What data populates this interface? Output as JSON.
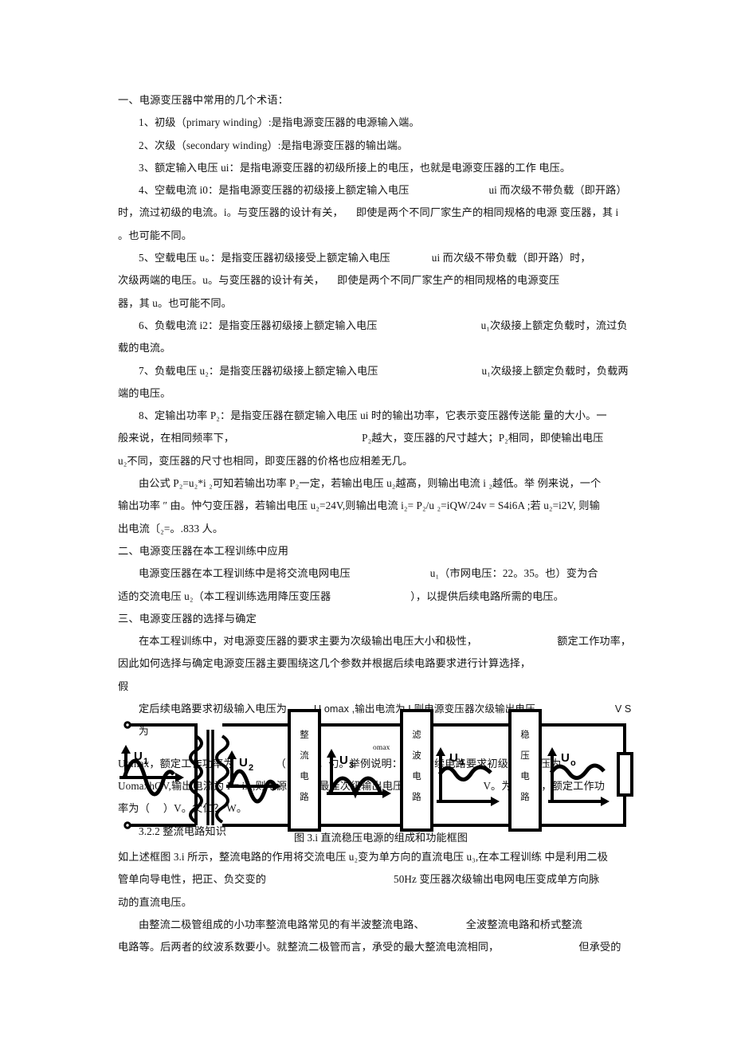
{
  "document": {
    "section1_title": "一、电源变压器中常用的几个术语：",
    "terms": [
      "1、初级（primary winding）:是指电源变压器的电源输入端。",
      "2、次级（secondary winding）:是指电源变压器的输出端。",
      "3、额定输入电压 ui：是指电源变压器的初级所接上的电压，也就是电源变压器的工作 电压。"
    ],
    "para_i0_l1": "4、空载电流 i0：是指电源变压器的初级接上额定输入电压",
    "para_i0_l1b": "ui 而次级不带负载（即开路）",
    "para_i0_l2": "时，流过初级的电流。i。与变压器的设计有关，",
    "para_i0_l2b": "即使是两个不同厂家生产的相同规格的电源 变压器，其 i",
    "para_i0_l3": "。也可能不同。",
    "para_u0_l1": "5、空载电压 u。：是指变压器初级接受上额定输入电压",
    "para_u0_l1b": "ui 而次级不带负载（即开路）时，",
    "para_u0_l2": "次级两端的电压。u。与变压器的设计有关，",
    "para_u0_l2b": "即使是两个不同厂家生产的相同规格的电源变压",
    "para_u0_l3": "器，其 u。也可能不同。",
    "para_i2_l1": "6、负载电流 i2：是指变压器初级接上额定输入电压",
    "para_i2_l1b": "u₁次级接上额定负载时，流过负",
    "para_i2_l2": "载的电流。",
    "para_u2_l1": "7、负载电压 u₂：是指变压器初级接上额定输入电压",
    "para_u2_l1b": "u₁次级接上额定负载时，负载两",
    "para_u2_l2": "端的电压。",
    "para_p2_l1": "8、定输出功率 P₂：是指变压器在额定输入电压 ui 时的输出功率，它表示变压器传送能 量的大小。一",
    "para_p2_l2": "般来说，在相同频率下，",
    "para_p2_l2b": "P₂越大，变压器的尺寸越大；P₂相同，即使输出电压",
    "para_p2_l3": "u₂不同，变压器的尺寸也相同，即变压器的价格也应相差无几。",
    "para_formula_l1": "由公式 P₂=u₂*i ₂可知若输出功率 P₂一定，若输出电压 u₂越高，则输出电流 i ₂越低。举 例来说，一个",
    "para_formula_l2": "输出功率 ″ 由。忡勺变压器，若输出电压 u₂=24V,则输出电流 i₂= P₂/u ₂=iQW/24v = S4i6A ;若 u₂=i2V, 则输",
    "para_formula_l3": "出电流〔₂=。.833 人。",
    "section2_title": "二、电源变压器在本工程训练中应用",
    "para_app_l1": "电源变压器在本工程训练中是将交流电网电压",
    "para_app_l1b": "u₁（市网电压：22。35。也）变为合",
    "para_app_l2": "适的交流电压 u₂（本工程训练选用降压变压器",
    "para_app_l2b": "），以提供后续电路所需的电压。",
    "section3_title": "三、电源变压器的选择与确定",
    "para_sel_l1": "在本工程训练中，对电源变压器的要求主要为次级输出电压大小和极性，",
    "para_sel_l1b": "额定工作功率，",
    "para_sel_l2": "因此如何选择与确定电源变压器主要围绕这几个参数并根据后续电路要求进行计算选择，",
    "para_sel_l2b": "假",
    "para_sel_l3": "定后续电路要求初级输入电压为",
    "para_sel_l3b": "U omax ,输出电流为 I,则电源变压器次级输出电压",
    "para_sel_l3c": "V S 为",
    "para_sel_l3_sub": "omax",
    "para_sel_l4": "Uomax，额定工作功率为",
    "para_sel_l4b": "（     ）V。勺。举例说明：假定后续电路要求初级输入电压为",
    "para_sel_l5": "UomaxhOV,输出电流为 I = iA,则电源变压器最佳次级输出电压",
    "para_sel_l5b": "V。为 1。丫，额定工作功",
    "para_sel_l6": "率为（     ）V。父仁？ W。",
    "subsection_title": "3.2.2 整流电路知识",
    "figure_caption": "图 3.i 直流稳压电源的组成和功能框图",
    "para_after_l1": "如上述框图 3.i 所示，整流电路的作用将交流电压 u₂变为单方向的直流电压 u₃,在本工程训练 中是利用二极",
    "para_after_l2": "管单向导电性，把正、负交变的",
    "para_after_l2b": "50Hz 变压器次级输出电网电压变成单方向脉",
    "para_after_l3": "动的直流电压。",
    "para_after_l4": "由整流二极管组成的小功率整流电路常见的有半波整流电路、",
    "para_after_l4b": "全波整流电路和桥式整流",
    "para_after_l5": "电路等。后两者的纹波系数要小。就整流二极管而言，承受的最大整流电流相同，",
    "para_after_l5b": "但承受的"
  },
  "figure": {
    "blocks": [
      {
        "id": "rectifier",
        "label": "整流电路",
        "chars": [
          "整",
          "流",
          "电",
          "路"
        ]
      },
      {
        "id": "filter",
        "label": "滤波电路",
        "chars": [
          "滤",
          "波",
          "电",
          "路"
        ]
      },
      {
        "id": "regulator",
        "label": "稳压电路",
        "chars": [
          "稳",
          "压",
          "电",
          "路"
        ]
      }
    ],
    "waveforms": [
      {
        "id": "u1",
        "label": "U",
        "sub": "1",
        "type": "sine"
      },
      {
        "id": "u2",
        "label": "U",
        "sub": "2",
        "type": "sine"
      },
      {
        "id": "u3",
        "label": "U",
        "sub": "3",
        "type": "full-wave-rectified"
      },
      {
        "id": "u4",
        "label": "U",
        "sub": "4",
        "type": "ripple"
      },
      {
        "id": "uo",
        "label": "U",
        "sub": "o",
        "type": "ripple-flat"
      }
    ],
    "components": [
      {
        "id": "transformer",
        "label": "transformer"
      },
      {
        "id": "load-resistor",
        "label": "load"
      }
    ],
    "colors": {
      "line": "#000000",
      "background": "#ffffff"
    }
  }
}
